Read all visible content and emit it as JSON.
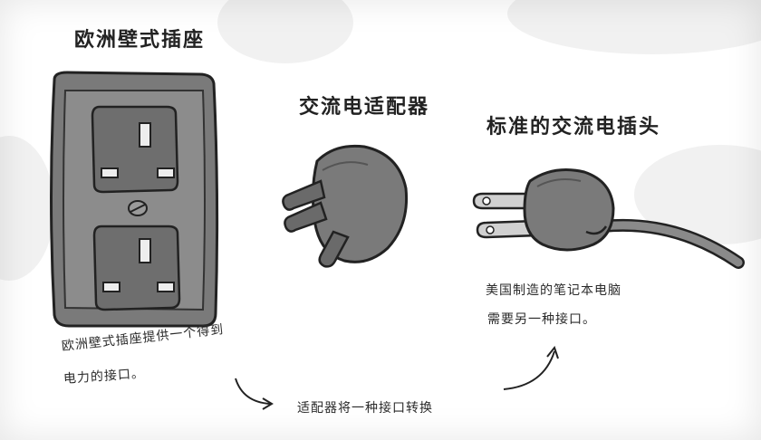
{
  "titles": {
    "socket": "欧洲壁式插座",
    "adapter": "交流电适配器",
    "plug": "标准的交流电插头"
  },
  "captions": {
    "socket_line1": "欧洲壁式插座提供一个得到",
    "socket_line2": "电力的接口。",
    "adapter_line": "适配器将一种接口转换",
    "laptop_line1": "美国制造的笔记本电脑",
    "laptop_line2": "需要另一种接口。"
  }
}
